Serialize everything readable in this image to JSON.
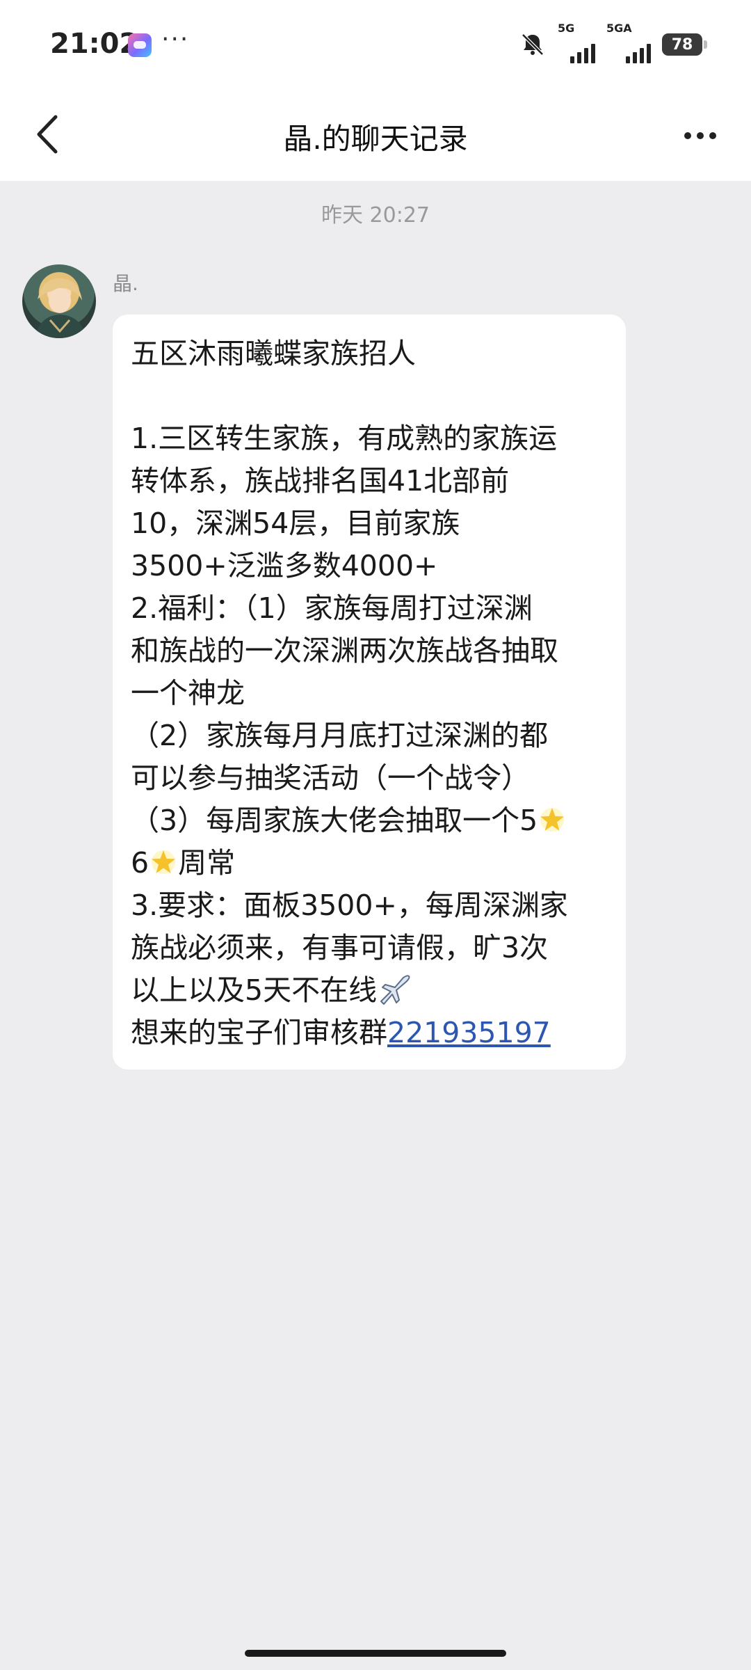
{
  "status_bar": {
    "time": "21:02",
    "app_icon": "game-center-icon",
    "overflow": "···",
    "signal1_label": "5G",
    "signal2_label": "5GA",
    "battery": "78"
  },
  "header": {
    "title": "晶.的聊天记录",
    "back_icon": "chevron-left-icon",
    "menu_icon": "more-dots-icon"
  },
  "chat": {
    "timestamp": "昨天 20:27",
    "sender_name": "晶.",
    "message": {
      "l1": "五区沐雨曦蝶家族招人",
      "l2": "1.三区转生家族，有成熟的家族运",
      "l3": "转体系，族战排名国41北部前",
      "l4": "10，深渊54层，目前家族",
      "l5": "3500+泛滥多数4000+",
      "l6": "2.福利：（1）家族每周打过深渊",
      "l7": "和族战的一次深渊两次族战各抽取",
      "l8": "一个神龙",
      "l9": "（2）家族每月月底打过深渊的都",
      "l10": "可以参与抽奖活动（一个战令）",
      "l11": "（3）每周家族大佬会抽取一个5",
      "l12a": "6",
      "l12b": "周常",
      "l13": "3.要求：面板3500+，每周深渊家",
      "l14": "族战必须来，有事可请假，旷3次",
      "l15": "以上以及5天不在线",
      "l16": "想来的宝子们审核群",
      "group_number": "221935197"
    },
    "emojis": [
      "glowing-star-icon",
      "airplane-icon"
    ]
  },
  "colors": {
    "background": "#ededf0",
    "bubble": "#ffffff",
    "link": "#2d56b0"
  }
}
